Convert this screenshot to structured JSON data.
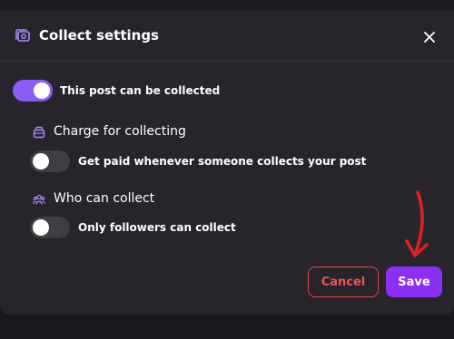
{
  "dialog": {
    "title": "Collect settings",
    "header_icon": "collect-icon",
    "close_icon": "close-icon"
  },
  "main_toggle": {
    "label": "This post can be collected",
    "state": "on"
  },
  "charge_section": {
    "title": "Charge for collecting",
    "icon": "wallet-icon",
    "toggle_label": "Get paid whenever someone collects your post",
    "toggle_state": "off"
  },
  "who_section": {
    "title": "Who can collect",
    "icon": "people-icon",
    "toggle_label": "Only followers can collect",
    "toggle_state": "off"
  },
  "actions": {
    "cancel_label": "Cancel",
    "save_label": "Save"
  },
  "colors": {
    "accent": "#8b5cf6",
    "save": "#8b2ff2",
    "cancel": "#e0454b",
    "annotation_arrow": "#e02020"
  }
}
